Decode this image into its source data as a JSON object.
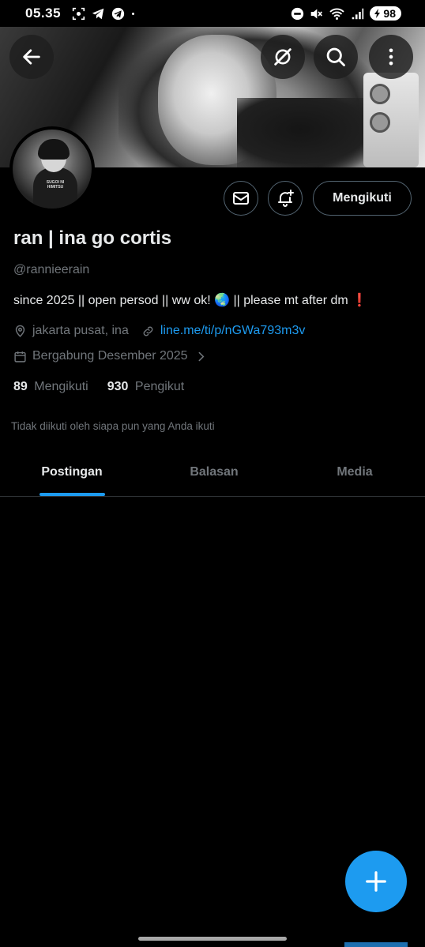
{
  "status_bar": {
    "time": "05.35",
    "battery": "98",
    "icons": [
      "screenshot-icon",
      "telegram-icon",
      "telegram-icon",
      "dot-icon",
      "dnd-icon",
      "mute-icon",
      "wifi-icon",
      "signal-icon",
      "battery-icon"
    ]
  },
  "header": {
    "back_icon": "arrow-left-icon",
    "grok_icon": "grok-icon",
    "search_icon": "search-icon",
    "more_icon": "more-vertical-icon"
  },
  "avatar": {
    "shirt_text": "SUGOI NI HIMITSU"
  },
  "actions": {
    "message_icon": "envelope-icon",
    "notify_icon": "bell-plus-icon",
    "follow_label": "Mengikuti"
  },
  "profile": {
    "name": "ran | ina go cortis",
    "handle": "@rannieerain",
    "bio": "since 2025 || open persod || ww ok! 🌏 || please mt after dm ❗",
    "location": "jakarta pusat, ina",
    "link": "line.me/ti/p/nGWa793m3v",
    "joined": "Bergabung Desember 2025",
    "following_count": "89",
    "following_label": "Mengikuti",
    "followers_count": "930",
    "followers_label": "Pengikut",
    "not_followed_note": "Tidak diikuti oleh siapa pun yang Anda ikuti"
  },
  "tabs": [
    {
      "label": "Postingan",
      "active": true
    },
    {
      "label": "Balasan",
      "active": false
    },
    {
      "label": "Media",
      "active": false
    }
  ],
  "fab": {
    "icon": "plus-icon"
  },
  "colors": {
    "accent": "#1d9bf0",
    "background": "#000000",
    "muted": "#71767b",
    "border": "#536471"
  }
}
